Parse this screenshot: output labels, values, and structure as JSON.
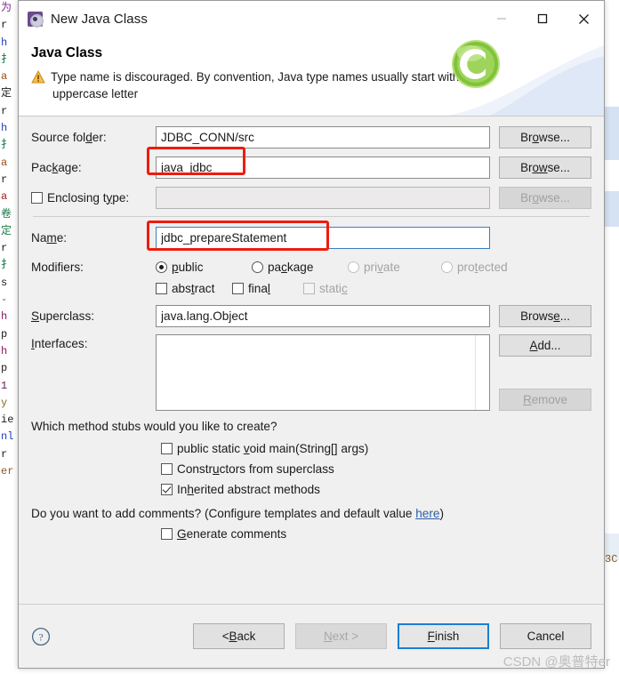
{
  "window": {
    "title": "New Java Class",
    "icon": "java-class-icon",
    "controls": {
      "minimize": "minimize-icon",
      "maximize": "maximize-icon",
      "close": "close-icon"
    }
  },
  "banner": {
    "title": "Java Class",
    "status_icon": "warning-icon",
    "message_line1": "Type name is discouraged. By convention, Java type names usually start with an",
    "message_line2": "uppercase letter",
    "art_icon": "green-c-sphere-icon"
  },
  "form": {
    "source_folder": {
      "label": "Source folder:",
      "label_mnemonic": "d",
      "value": "JDBC_CONN/src",
      "browse": "Browse...",
      "browse_mnemonic": "o"
    },
    "package": {
      "label": "Package:",
      "label_mnemonic": "k",
      "value": "java_jdbc",
      "browse": "Browse...",
      "browse_mnemonic": "ow"
    },
    "enclosing_type": {
      "label": "Enclosing type:",
      "label_mnemonic": "y",
      "checked": false,
      "value": "",
      "browse": "Browse...",
      "browse_disabled": true
    },
    "name": {
      "label": "Name:",
      "label_mnemonic": "m",
      "value": "jdbc_prepareStatement",
      "focused": true
    },
    "modifiers": {
      "label": "Modifiers:",
      "access": [
        {
          "label": "public",
          "mnemonic": "p",
          "selected": true,
          "disabled": false
        },
        {
          "label": "package",
          "mnemonic": "c",
          "selected": false,
          "disabled": false
        },
        {
          "label": "private",
          "mnemonic": "v",
          "selected": false,
          "disabled": true
        },
        {
          "label": "protected",
          "mnemonic": "t",
          "selected": false,
          "disabled": true
        }
      ],
      "flags": [
        {
          "label": "abstract",
          "mnemonic": "t",
          "checked": false,
          "disabled": false
        },
        {
          "label": "final",
          "mnemonic": "l",
          "checked": false,
          "disabled": false
        },
        {
          "label": "static",
          "mnemonic": "c",
          "checked": false,
          "disabled": true
        }
      ]
    },
    "superclass": {
      "label": "Superclass:",
      "label_mnemonic": "S",
      "value": "java.lang.Object",
      "browse": "Browse...",
      "browse_mnemonic": "e"
    },
    "interfaces": {
      "label": "Interfaces:",
      "label_mnemonic": "I",
      "items": [],
      "add": "Add...",
      "add_mnemonic": "A",
      "remove": "Remove",
      "remove_mnemonic": "R",
      "remove_disabled": true
    }
  },
  "stubs": {
    "question": "Which method stubs would you like to create?",
    "options": [
      {
        "label": "public static void main(String[] args)",
        "mnemonic": "v",
        "checked": false
      },
      {
        "label": "Constructors from superclass",
        "mnemonic": "u",
        "checked": false
      },
      {
        "label": "Inherited abstract methods",
        "mnemonic": "h",
        "checked": true
      }
    ]
  },
  "comments": {
    "question_prefix": "Do you want to add comments? (Configure templates and default value ",
    "link": "here",
    "question_suffix": ")",
    "option": {
      "label": "Generate comments",
      "mnemonic": "G",
      "checked": false
    }
  },
  "footer": {
    "help_icon": "help-icon",
    "buttons": [
      {
        "label": "< Back",
        "mnemonic": "B",
        "disabled": false,
        "default": false
      },
      {
        "label": "Next >",
        "mnemonic": "N",
        "disabled": true,
        "default": false
      },
      {
        "label": "Finish",
        "mnemonic": "F",
        "disabled": false,
        "default": true
      },
      {
        "label": "Cancel",
        "mnemonic": "",
        "disabled": false,
        "default": false
      }
    ]
  },
  "annotations": {
    "highlight_package": "red-box-around-package-value",
    "highlight_name": "red-box-around-name-value"
  },
  "watermark": "CSDN @奥普特er",
  "background_editor": {
    "left_gutter_chars": [
      "为",
      "r",
      "h",
      "扌",
      "a",
      "定",
      "r",
      "h",
      "扌",
      "a",
      "r",
      "a",
      "卷",
      "定",
      "r",
      "扌",
      "s",
      "-",
      "h",
      "p",
      "h",
      "p",
      "1",
      "y",
      "ie",
      "nl",
      "r",
      "er"
    ],
    "right_text": "3C"
  },
  "colors": {
    "accent": "#1a7fd4",
    "annotation": "#f01b0e",
    "warning": "#f5b433",
    "link": "#2b5fa8",
    "dialog_bg": "#f0f0f0"
  }
}
